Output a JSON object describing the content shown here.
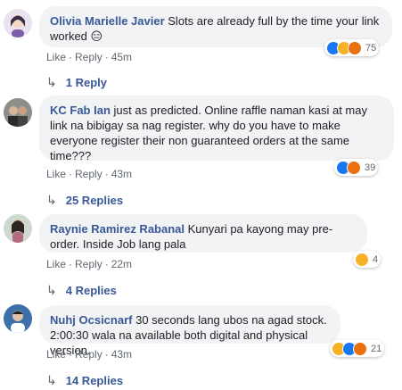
{
  "comments": [
    {
      "author": "Olivia Marielle Javier",
      "text": "Slots are already full by the time your link worked",
      "emoji": "😑",
      "actions": {
        "like": "Like",
        "reply": "Reply",
        "time": "45m"
      },
      "reaction_count": "75",
      "reaction_icons": [
        "like-icon",
        "haha-icon",
        "angry-icon"
      ],
      "replies": "1 Reply"
    },
    {
      "author": "KC Fab Ian",
      "text": "just as predicted. Online raffle naman kasi at may link na bibigay sa nag register. why do you have to make everyone register their non guaranteed orders at the same time???",
      "actions": {
        "like": "Like",
        "reply": "Reply",
        "time": "43m"
      },
      "reaction_count": "39",
      "reaction_icons": [
        "like-icon",
        "angry-icon"
      ],
      "replies": "25 Replies"
    },
    {
      "author": "Raynie Ramirez Rabanal",
      "text": "Kunyari pa kayong may pre-order. Inside Job lang pala",
      "actions": {
        "like": "Like",
        "reply": "Reply",
        "time": "22m"
      },
      "reaction_count": "4",
      "reaction_icons": [
        "haha-icon"
      ],
      "replies": "4 Replies"
    },
    {
      "author": "Nuhj Ocsicnarf",
      "text": "30 seconds lang ubos na agad stock. 2:00:30 wala na available both digital and physical version.",
      "actions": {
        "like": "Like",
        "reply": "Reply",
        "time": "43m"
      },
      "reaction_count": "21",
      "reaction_icons": [
        "haha-icon",
        "like-icon",
        "angry-icon"
      ],
      "replies": "14 Replies"
    }
  ],
  "colors": {
    "link": "#385898",
    "bubble": "#f2f3f5",
    "meta": "#606770"
  }
}
